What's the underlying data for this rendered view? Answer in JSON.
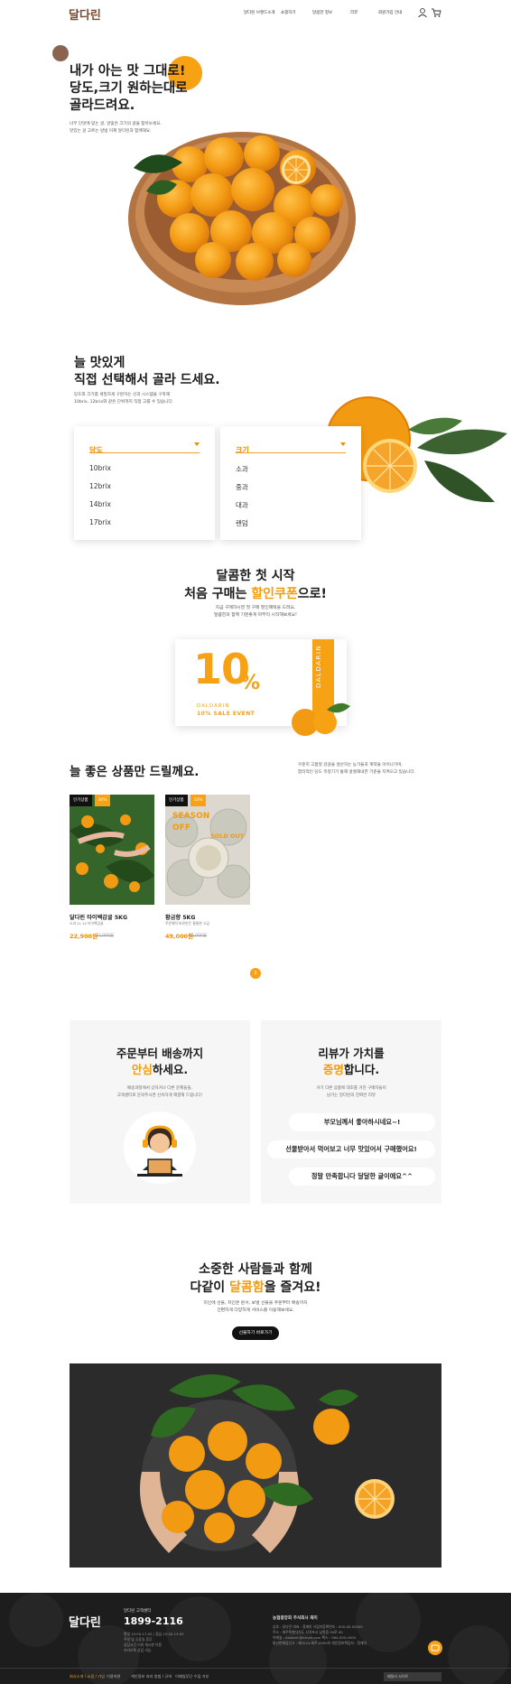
{
  "header": {
    "logo": "달다린",
    "nav": [
      "달다린 브랜드소개",
      "쇼핑하기",
      "달콤한 정보",
      "리뷰",
      "회원가입 안내"
    ]
  },
  "hero": {
    "title_lines": [
      "내가 아는 맛 그대로!",
      "당도,크기 원하는대로",
      "골라드려요."
    ],
    "sub_lines": [
      "너무 단맛에 맞는 귤, 알맞은 크기의 귤을 찾아보세요.",
      "맛있는 귤 고르는 방법 이제 달다린과 함께해요."
    ]
  },
  "selection": {
    "title_lines": [
      "늘 맛있게",
      "직접 선택해서 골라 드세요."
    ],
    "sub_lines": [
      "당도와 크기를 세밀하게 구분하는 선과 시스템을 구축해",
      "10brix, 12brix와 같은 단위까지 직접 고를 수 있습니다."
    ],
    "sweetness": {
      "label": "당도",
      "options": [
        "10brix",
        "12brix",
        "14brix",
        "17brix"
      ]
    },
    "size": {
      "label": "크기",
      "options": [
        "소과",
        "중과",
        "대과",
        "랜덤"
      ]
    }
  },
  "coupon": {
    "title_line1": "달콤한 첫 시작",
    "title_prefix": "처음 구매는 ",
    "title_highlight": "할인쿠폰",
    "title_suffix": "으로!",
    "sub_lines": [
      "지금 구매하시면 첫 구매 할인혜택을 드려요.",
      "달콤한과 함께 기분좋게 마무리 시작해보세요!"
    ],
    "percent": "10",
    "percent_sign": "%",
    "brand": "DALDARIN",
    "event": "10% SALE EVENT",
    "tab": "DALDARIN"
  },
  "products": {
    "title": "늘 좋은 상품만 드릴께요.",
    "desc_lines": [
      "꾸준히 고품질 감귤을 생산하는 농가들과 계약을 이어나가며,",
      "합리적인 당도 측정기기 통해 골절해내한 기준을 지켜오고 있습니다."
    ],
    "items": [
      {
        "badge": "인기상품",
        "discount": "30%",
        "name": "달다린 타이벡감귤 5KG",
        "meta": "소과 2L 14 타이벡감귤",
        "price": "22,900원",
        "old_price": "32,000원"
      },
      {
        "badge": "인기상품",
        "discount": "10%",
        "name": "황금향 5KG",
        "meta": "주문제작 바로만든 통통한 고급",
        "price": "49,000원",
        "old_price": "55,000원",
        "overlay_line1": "SEASON",
        "overlay_line2": "OFF",
        "overlay_line3": "SOLD OUT"
      }
    ],
    "pager": "1"
  },
  "features": {
    "delivery": {
      "title_line1": "주문부터 배송까지",
      "title_highlight": "안심",
      "title_suffix": "하세요.",
      "sub_lines": [
        "배송과정에서 상하거나 다른 문제들을,",
        "고객센터로 문의주시면 신속하게 해결해 드립니다!"
      ]
    },
    "review": {
      "title_line1": "리뷰가 가치를",
      "title_highlight": "증명",
      "title_suffix": "합니다.",
      "sub_lines": [
        "거기 다른 상품에 대조를 거친 구매자들이",
        "남기는 달다린의 진짜한 리뷰"
      ],
      "bubbles": [
        "부모님께서 좋아하시네요~!",
        "선물받아서 먹어보고 너무 맛있어서 구매했어요!",
        "정말 만족합니다 달달한 귤이에요^^"
      ]
    }
  },
  "share": {
    "title_line1": "소중한 사람들과 함께",
    "title_prefix": "다같이 ",
    "title_highlight": "달콤함",
    "title_suffix": "을 즐겨요!",
    "sub_lines": [
      "지인에 선물, 지인분 문서, 보낼 선물을 주문부터 배송까지",
      "간편하게 다양하게 서비스를 이용해보세요."
    ],
    "button": "선물하기 바로가기"
  },
  "footer": {
    "logo": "달다린",
    "cs_label": "달다린 고객센터",
    "phone": "1899-2116",
    "info_lines": [
      "평일 10:00-17:00 / 점심 12:00-13:00",
      "주말 및 공휴일 휴무",
      "상담시간 이외 게시판 이용",
      "카카오톡 상담 가능"
    ],
    "account_title": "농협중앙회 주식회사 재미",
    "account_lines": [
      "상호 : 달다린 대표 : 정재미 사업자등록번호 : 000-00-00000",
      "주소 : 제주특별자치도 서귀포시 남원읍 00로 00",
      "이메일 : daldarin@email.com 팩스 : 064-000-0000",
      "통신판매업신고 : 제2024-제주-0000호 개인정보책임자 : 정재미"
    ],
    "links": [
      "회사소개 / 쇼핑 / 가입",
      "이용약관",
      "개인정보 처리 방침 / 규약",
      "이메일무단 수집 거부"
    ],
    "select": "패밀리 사이트"
  }
}
